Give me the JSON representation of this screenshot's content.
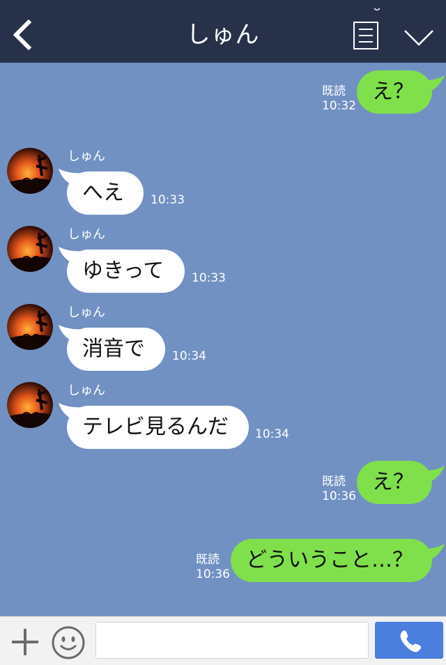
{
  "header": {
    "title": "しゅん"
  },
  "messages": [
    {
      "dir": "out",
      "text": "え？",
      "time": "10:32",
      "read": "既読"
    },
    {
      "dir": "in",
      "sender": "しゅん",
      "text": "へえ",
      "time": "10:33"
    },
    {
      "dir": "in",
      "sender": "しゅん",
      "text": "ゆきって",
      "time": "10:33"
    },
    {
      "dir": "in",
      "sender": "しゅん",
      "text": "消音で",
      "time": "10:34"
    },
    {
      "dir": "in",
      "sender": "しゅん",
      "text": "テレビ見るんだ",
      "time": "10:34"
    },
    {
      "dir": "out",
      "text": "え？",
      "time": "10:36",
      "read": "既読"
    },
    {
      "dir": "out",
      "text": "どういうこと…？",
      "time": "10:36",
      "read": "既読"
    }
  ],
  "footer": {
    "input_value": "",
    "input_placeholder": ""
  },
  "colors": {
    "header_bg": "#27324a",
    "chat_bg": "#7191c2",
    "outgoing_bubble": "#7fe04b",
    "incoming_bubble": "#ffffff",
    "call_button": "#4a7fde"
  },
  "icons": {
    "back": "chevron-left-icon",
    "menu": "menu-icon",
    "collapse": "chevron-down-icon",
    "add": "plus-icon",
    "emoji": "smiley-icon",
    "call": "phone-icon"
  }
}
